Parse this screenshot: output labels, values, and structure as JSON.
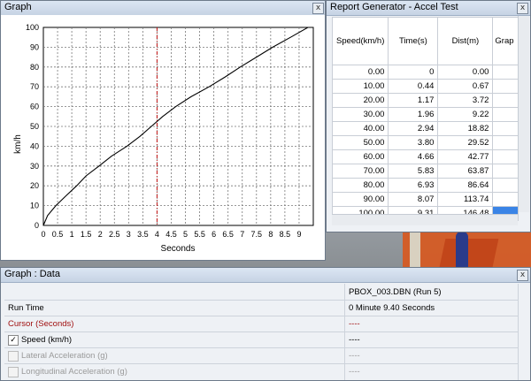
{
  "graph": {
    "title": "Graph",
    "close": "x",
    "ylabel": "km/h",
    "xlabel": "Seconds"
  },
  "chart_data": {
    "type": "line",
    "xlabel": "Seconds",
    "ylabel": "km/h",
    "xlim": [
      0,
      9.5
    ],
    "ylim": [
      0,
      100
    ],
    "grid": true,
    "x_ticks": [
      "0",
      "0.5",
      "1",
      "1.5",
      "2",
      "2.5",
      "3",
      "3.5",
      "4",
      "4.5",
      "5",
      "5.5",
      "6",
      "6.5",
      "7",
      "7.5",
      "8",
      "8.5",
      "9"
    ],
    "y_ticks": [
      "0",
      "10",
      "20",
      "30",
      "40",
      "50",
      "60",
      "70",
      "80",
      "90",
      "100"
    ],
    "cursor_x": 4.0,
    "series": [
      {
        "x": [
          0,
          0.15,
          0.44,
          0.8,
          1.17,
          1.5,
          1.96,
          2.4,
          2.94,
          3.4,
          3.8,
          4.2,
          4.66,
          5.2,
          5.83,
          6.4,
          6.93,
          7.5,
          8.07,
          8.7,
          9.31,
          9.4
        ],
        "y": [
          0,
          5,
          10,
          15,
          20,
          25,
          30,
          35,
          40,
          45,
          50,
          55,
          60,
          65,
          70,
          75,
          80,
          85,
          90,
          95,
          100,
          100
        ]
      }
    ]
  },
  "report": {
    "title": "Report Generator - Accel Test",
    "close": "x",
    "headers": [
      "Speed(km/h)",
      "Time(s)",
      "Dist(m)",
      "Grap"
    ],
    "rows": [
      [
        "0.00",
        "0",
        "0.00"
      ],
      [
        "10.00",
        "0.44",
        "0.67"
      ],
      [
        "20.00",
        "1.17",
        "3.72"
      ],
      [
        "30.00",
        "1.96",
        "9.22"
      ],
      [
        "40.00",
        "2.94",
        "18.82"
      ],
      [
        "50.00",
        "3.80",
        "29.52"
      ],
      [
        "60.00",
        "4.66",
        "42.77"
      ],
      [
        "70.00",
        "5.83",
        "63.87"
      ],
      [
        "80.00",
        "6.93",
        "86.64"
      ],
      [
        "90.00",
        "8.07",
        "113.74"
      ],
      [
        "100.00",
        "9.31",
        "146.48"
      ]
    ]
  },
  "data_panel": {
    "title": "Graph : Data",
    "close": "x",
    "run_header": "PBOX_003.DBN (Run 5)",
    "rows": [
      {
        "label": "Run Time",
        "value": "0 Minute 9.40 Seconds"
      },
      {
        "label": "Cursor (Seconds)",
        "value": "----"
      },
      {
        "label": "Speed (km/h)",
        "value": "----"
      },
      {
        "label": "Lateral Acceleration (g)",
        "value": "----"
      },
      {
        "label": "Longitudinal Acceleration (g)",
        "value": "----"
      }
    ],
    "checkmark": "✓",
    "colors": {
      "cursor_label": "#a01010",
      "disabled_text": "#9a9a9a"
    }
  }
}
